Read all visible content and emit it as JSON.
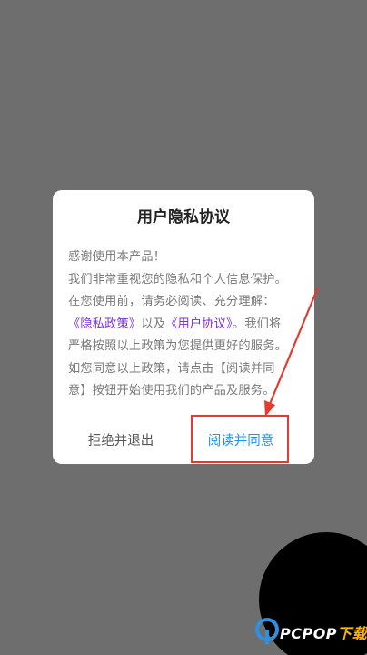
{
  "dialog": {
    "title": "用户隐私协议",
    "body": {
      "line1": "感谢使用本产品！",
      "line2": "我们非常重视您的隐私和个人信息保护。",
      "line3": "在您使用前，请务必阅读、充分理解：",
      "line4_link1": "《隐私政策》",
      "line4_mid": "以及",
      "line4_link2": "《用户协议》",
      "line4_end": "。我们将",
      "line5": "严格按照以上政策为您提供更好的服务。",
      "line6": "如您同意以上政策，请点击【阅读并同",
      "line7": "意】按钮开始使用我们的产品及服务。"
    },
    "buttons": {
      "reject_label": "拒绝并退出",
      "agree_label": "阅读并同意"
    }
  },
  "annotation": {
    "box_color": "#e53b2f"
  },
  "watermark": {
    "text_main": "PCPOP",
    "text_accent": "下载"
  },
  "colors": {
    "overlay": "#6e6e6e",
    "link": "#7b2fd6",
    "agree": "#1e90ff"
  }
}
